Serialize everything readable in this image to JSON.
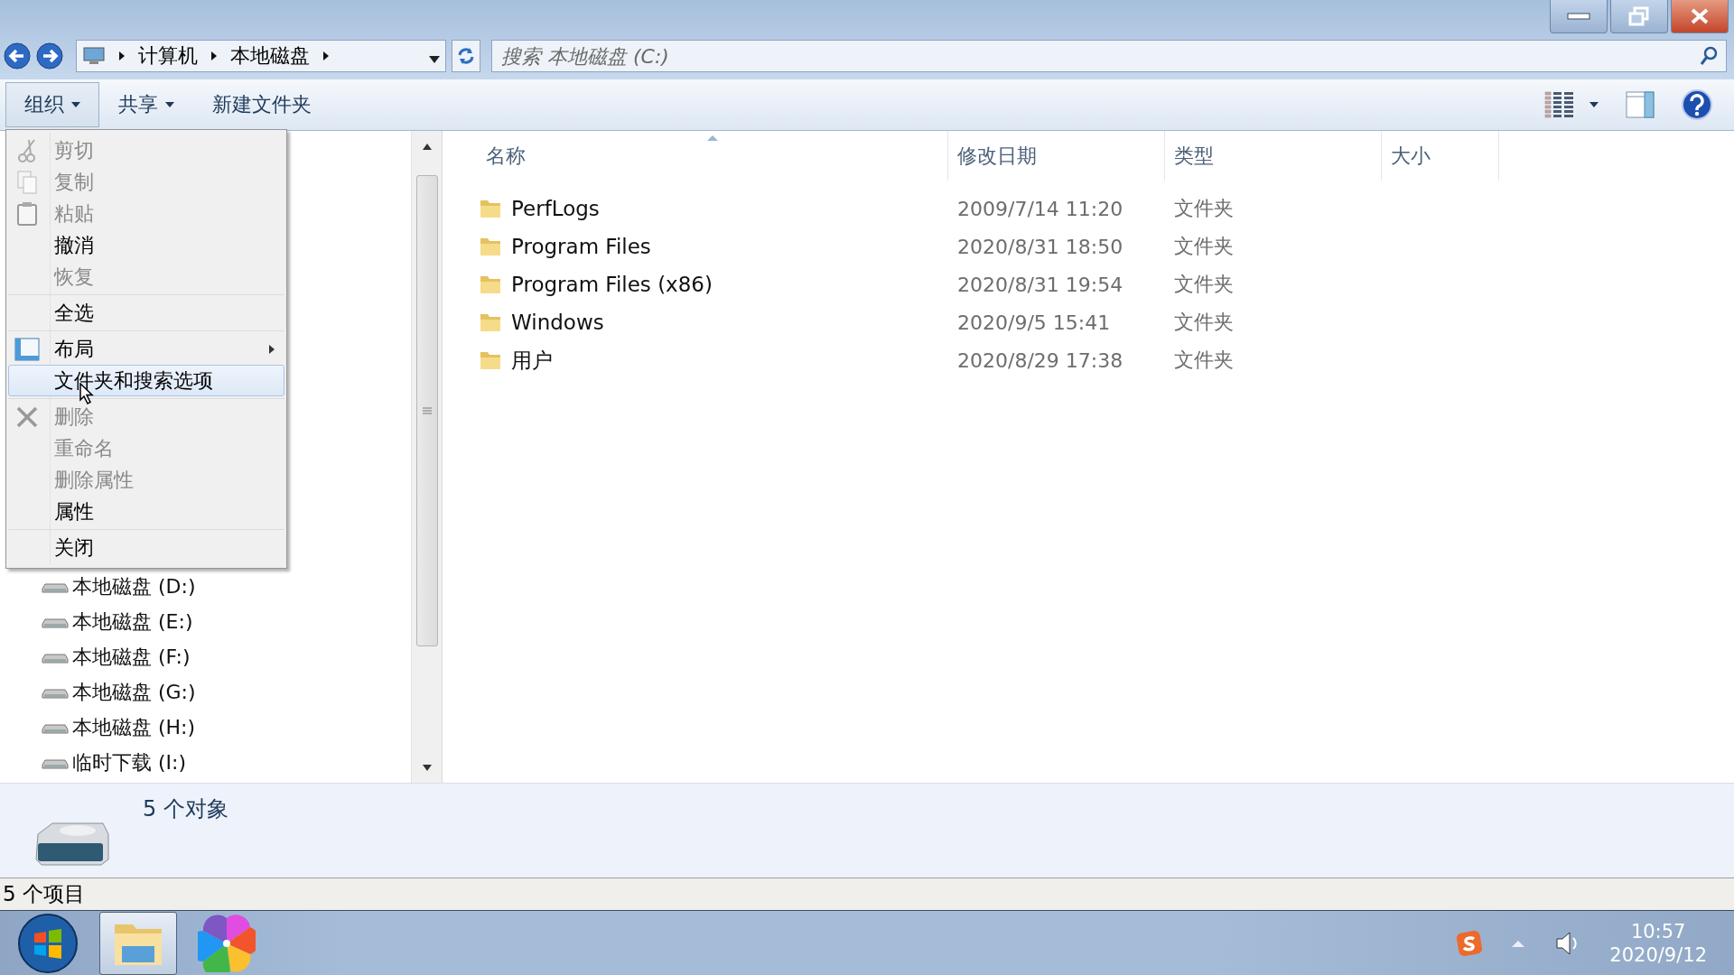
{
  "address": {
    "breadcrumb": [
      "计算机",
      "本地磁盘"
    ]
  },
  "search": {
    "placeholder": "搜索 本地磁盘 (C:)"
  },
  "toolbar": {
    "buttons": [
      {
        "label": "组织",
        "dropdown": true,
        "pressed": true
      },
      {
        "label": "共享",
        "dropdown": true,
        "pressed": false
      },
      {
        "label": "新建文件夹",
        "dropdown": false,
        "pressed": false
      }
    ]
  },
  "menu": {
    "groups": [
      [
        {
          "label": "剪切",
          "kind": "cut",
          "disabled": true,
          "selected": false,
          "submenu": false
        },
        {
          "label": "复制",
          "kind": "copy",
          "disabled": true,
          "selected": false,
          "submenu": false
        },
        {
          "label": "粘贴",
          "kind": "paste",
          "disabled": true,
          "selected": false,
          "submenu": false
        },
        {
          "label": "撤消",
          "kind": "plain",
          "disabled": false,
          "selected": false,
          "submenu": false
        },
        {
          "label": "恢复",
          "kind": "plain",
          "disabled": true,
          "selected": false,
          "submenu": false
        }
      ],
      [
        {
          "label": "全选",
          "kind": "plain",
          "disabled": false,
          "selected": false,
          "submenu": false
        }
      ],
      [
        {
          "label": "布局",
          "kind": "layout",
          "disabled": false,
          "selected": false,
          "submenu": true
        },
        {
          "label": "文件夹和搜索选项",
          "kind": "plain",
          "disabled": false,
          "selected": true,
          "submenu": false
        }
      ],
      [
        {
          "label": "删除",
          "kind": "delete",
          "disabled": true,
          "selected": false,
          "submenu": false
        },
        {
          "label": "重命名",
          "kind": "plain",
          "disabled": true,
          "selected": false,
          "submenu": false
        },
        {
          "label": "删除属性",
          "kind": "plain",
          "disabled": true,
          "selected": false,
          "submenu": false
        },
        {
          "label": "属性",
          "kind": "plain",
          "disabled": false,
          "selected": false,
          "submenu": false
        }
      ],
      [
        {
          "label": "关闭",
          "kind": "plain",
          "disabled": false,
          "selected": false,
          "submenu": false
        }
      ]
    ]
  },
  "navigation": {
    "items": [
      {
        "label": "本地磁盘 (D:)"
      },
      {
        "label": "本地磁盘 (E:)"
      },
      {
        "label": "本地磁盘 (F:)"
      },
      {
        "label": "本地磁盘 (G:)"
      },
      {
        "label": "本地磁盘 (H:)"
      },
      {
        "label": "临时下载 (I:)"
      }
    ]
  },
  "table": {
    "columns": [
      {
        "label": "名称",
        "sorted": true
      },
      {
        "label": "修改日期",
        "sorted": false
      },
      {
        "label": "类型",
        "sorted": false
      },
      {
        "label": "大小",
        "sorted": false
      }
    ],
    "rows": [
      {
        "name": "PerfLogs",
        "modified": "2009/7/14 11:20",
        "type": "文件夹"
      },
      {
        "name": "Program Files",
        "modified": "2020/8/31 18:50",
        "type": "文件夹"
      },
      {
        "name": "Program Files (x86)",
        "modified": "2020/8/31 19:54",
        "type": "文件夹"
      },
      {
        "name": "Windows",
        "modified": "2020/9/5 15:41",
        "type": "文件夹"
      },
      {
        "name": "用户",
        "modified": "2020/8/29 17:38",
        "type": "文件夹"
      }
    ]
  },
  "details": {
    "summary": "5 个对象"
  },
  "status_bar": {
    "text": "5 个项目"
  },
  "taskbar": {
    "apps": [
      {
        "kind": "explorer",
        "active": true
      },
      {
        "kind": "pinwheel",
        "active": false
      }
    ],
    "tray": {
      "time": "10:57",
      "date": "2020/9/12"
    }
  }
}
